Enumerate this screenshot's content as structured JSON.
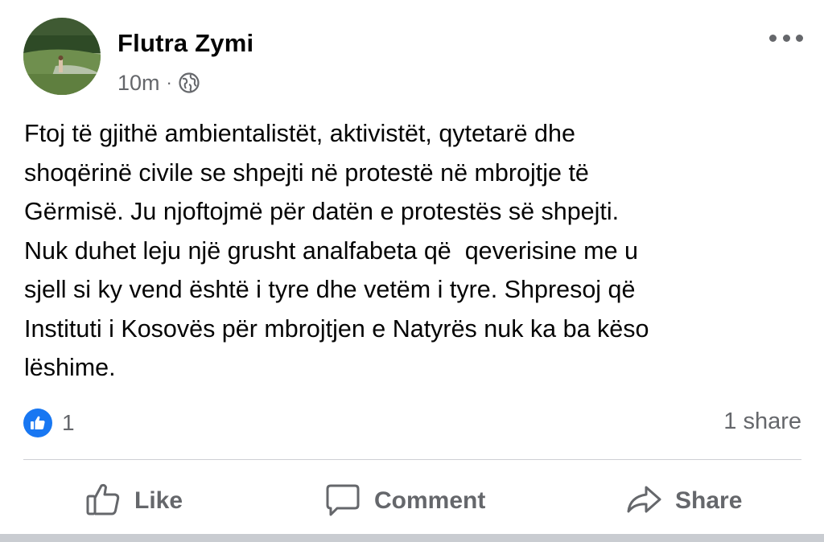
{
  "post": {
    "author": "Flutra Zymi",
    "time": "10m",
    "separator": "·",
    "privacy_icon": "globe-icon",
    "more_icon": "ellipsis-icon",
    "text": "Ftoj të gjithë ambientalistët, aktivistët, qytetarë dhe\nshoqërinë civile se shpejti në protestë në mbrojtje të\nGërmisë. Ju njoftojmë për datën e protestës së shpejti.\nNuk duhet leju një grusht analfabeta që  qeverisine me u\nsjell si ky vend është i tyre dhe vetëm i tyre. Shpresoj që\nInstituti i Kosovës për mbrojtjen e Natyrës nuk ka ba këso\nlëshime."
  },
  "stats": {
    "reaction_icon": "like-reaction-icon",
    "reaction_count": "1",
    "shares": "1 share"
  },
  "actions": {
    "like": "Like",
    "comment": "Comment",
    "share": "Share"
  },
  "colors": {
    "accent": "#1877f2",
    "secondary_text": "#65676b",
    "divider": "#ced0d4"
  }
}
